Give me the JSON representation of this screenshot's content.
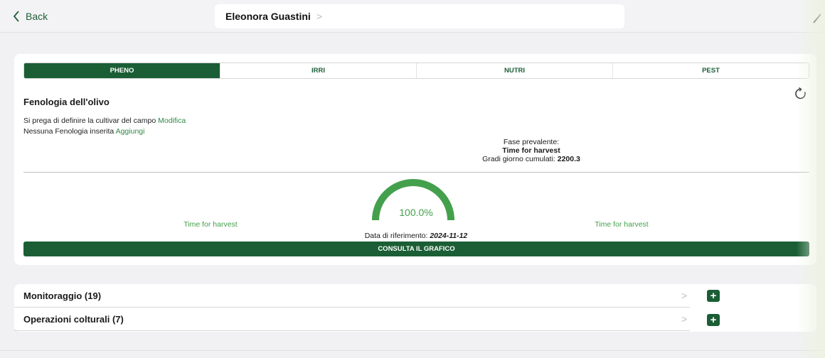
{
  "header": {
    "back_label": "Back",
    "title": "Eleonora Guastini",
    "title_chevron": ">"
  },
  "tabs": [
    {
      "label": "PHENO",
      "active": true
    },
    {
      "label": "IRRI",
      "active": false
    },
    {
      "label": "NUTRI",
      "active": false
    },
    {
      "label": "PEST",
      "active": false
    }
  ],
  "pheno": {
    "title": "Fenologia dell'olivo",
    "cultivar_note": "Si prega di definire la cultivar del campo",
    "cultivar_link": "Modifica",
    "phenology_note": "Nessuna Fenologia inserita",
    "phenology_link": "Aggiungi",
    "phase_label": "Fase prevalente:",
    "phase_value": "Time for harvest",
    "gdd_label": "Gradi giorno cumulati:",
    "gdd_value": "2200.3",
    "gauge_percent": "100.0%",
    "gauge_fraction": 1.0,
    "left_label": "Time for harvest",
    "right_label": "Time for harvest",
    "ref_date_label": "Data di riferimento:",
    "ref_date_value": "2024-11-12",
    "chart_button": "CONSULTA IL GRAFICO"
  },
  "lists": [
    {
      "label": "Monitoraggio (19)"
    },
    {
      "label": "Operazioni colturali (7)"
    }
  ],
  "icons": {
    "back": "chevron-left-icon",
    "refresh": "refresh-icon",
    "add": "plus-icon",
    "row_chevron": "chevron-right-icon"
  },
  "colors": {
    "brand_green": "#1b5e35",
    "link_green": "#2e8a45",
    "gauge_green": "#44a04c"
  }
}
